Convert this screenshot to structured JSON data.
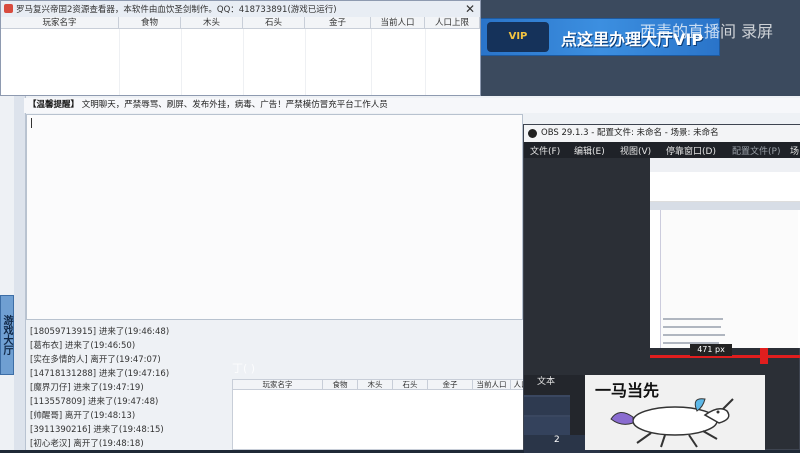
{
  "colors": {
    "lobby_bg": "#eef1f5",
    "obs_bg": "#2b2f36",
    "accent_blue": "#2a74c9",
    "red_marker": "#e01e1e"
  },
  "banner": {
    "badge": "VIP",
    "text": "点这里办理大厅VIP"
  },
  "watermark": "西毒的直播间 录屏",
  "dialog": {
    "title": "罗马复兴帝国2资源查看器，本软件由血饮圣剑制作。QQ：418733891(游戏已运行)",
    "close_icon": "close-icon",
    "columns": [
      "玩家名字",
      "食物",
      "木头",
      "石头",
      "金子",
      "当前人口",
      "人口上限"
    ]
  },
  "notice": {
    "label": "【温馨提醒】",
    "text": "文明聊天，严禁辱骂、刷屏、发布外挂，病毒、广告！严禁模仿冒充平台工作人员"
  },
  "side_tab": "游戏大厅",
  "log": [
    "[1805971391​5] 进来了(19:46:48)",
    "[葛布衣] 进来了(19:46:50)",
    "[实在多情的人] 离开了(19:47:07)",
    "[1471813128​8] 进来了(19:47:16)",
    "[魔界刀仔] 进来了(19:47:19)",
    "[113557809] 进来了(19:47:48)",
    "[帅醒哥] 离开了(19:48:13)",
    "[391139021​6] 进来了(19:48:15)",
    "[初心老汉] 离开了(19:48:18)"
  ],
  "obs": {
    "title": "OBS 29.1.3 - 配置文件: 未命名 - 场景: 未命名",
    "menu": [
      "文件(F)",
      "编辑(E)",
      "视图(V)",
      "停靠窗口(D)",
      "配置文件(P)",
      "场"
    ],
    "preview_px": "471 px",
    "text_label": "文本",
    "dock_numbers": [
      "2"
    ]
  },
  "second_grid": {
    "columns": [
      "玩家名字",
      "食物",
      "木头",
      "石头",
      "金子",
      "当前人口",
      "人口上限"
    ]
  },
  "ghost_text": "丁( )",
  "sticker": {
    "text": "一马当先"
  }
}
